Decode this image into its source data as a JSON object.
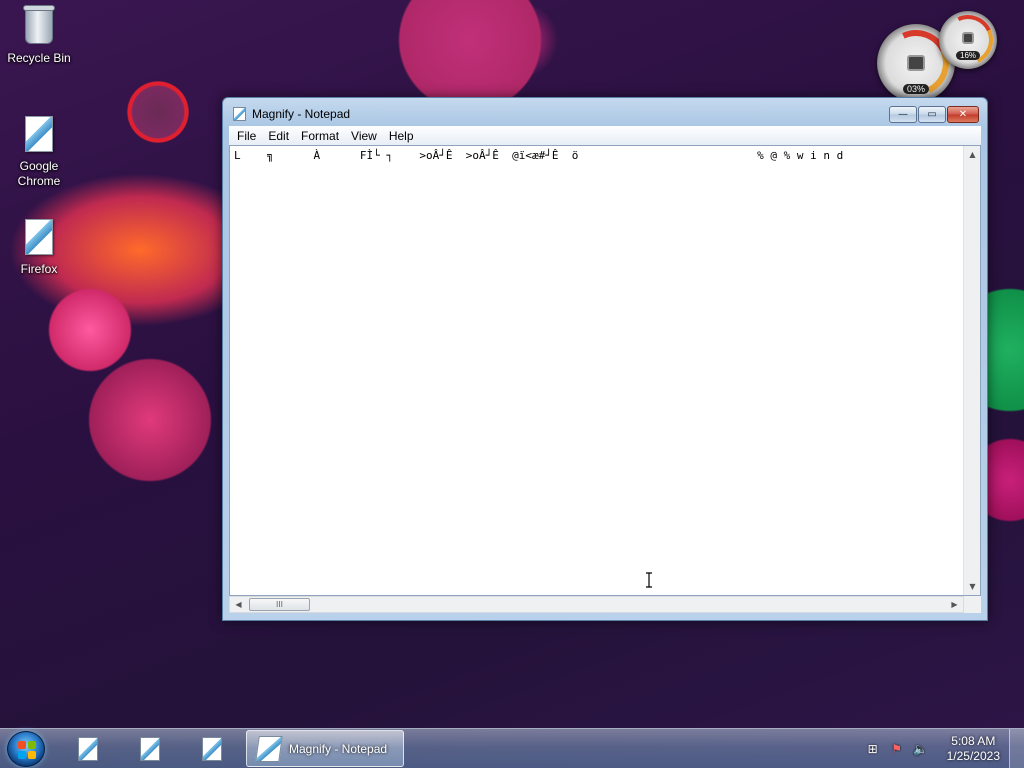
{
  "desktop": {
    "icons": [
      {
        "label": "Recycle Bin",
        "icon": "recycle-bin-icon"
      },
      {
        "label": "Google Chrome",
        "icon": "document-shortcut-icon"
      },
      {
        "label": "Firefox",
        "icon": "document-shortcut-icon"
      }
    ],
    "gadgets": {
      "cpu_percent": "03%",
      "memory_percent": "16%"
    }
  },
  "window": {
    "title": "Magnify - Notepad",
    "menu": [
      "File",
      "Edit",
      "Format",
      "View",
      "Help"
    ],
    "content": "L    ╗      À      FÌ└ ┐    >oÂ┘Ê  >oÂ┘Ê  @ï<æ#┘Ê  ö                           % @ % w i n d",
    "hscroll_grip": "III",
    "buttons": {
      "minimize": "—",
      "maximize": "▭",
      "close": "✕"
    }
  },
  "taskbar": {
    "active_task": "Magnify - Notepad",
    "clock": {
      "time": "5:08 AM",
      "date": "1/25/2023"
    },
    "tray_icons": [
      "network-icon",
      "action-center-flag-icon",
      "volume-icon"
    ]
  },
  "colors": {
    "accent_titlebar": "#b9d1ea",
    "close_button": "#c23a2a",
    "win_flag_red": "#f25022",
    "win_flag_green": "#7fba00",
    "win_flag_blue": "#00a4ef",
    "win_flag_yellow": "#ffb900"
  }
}
